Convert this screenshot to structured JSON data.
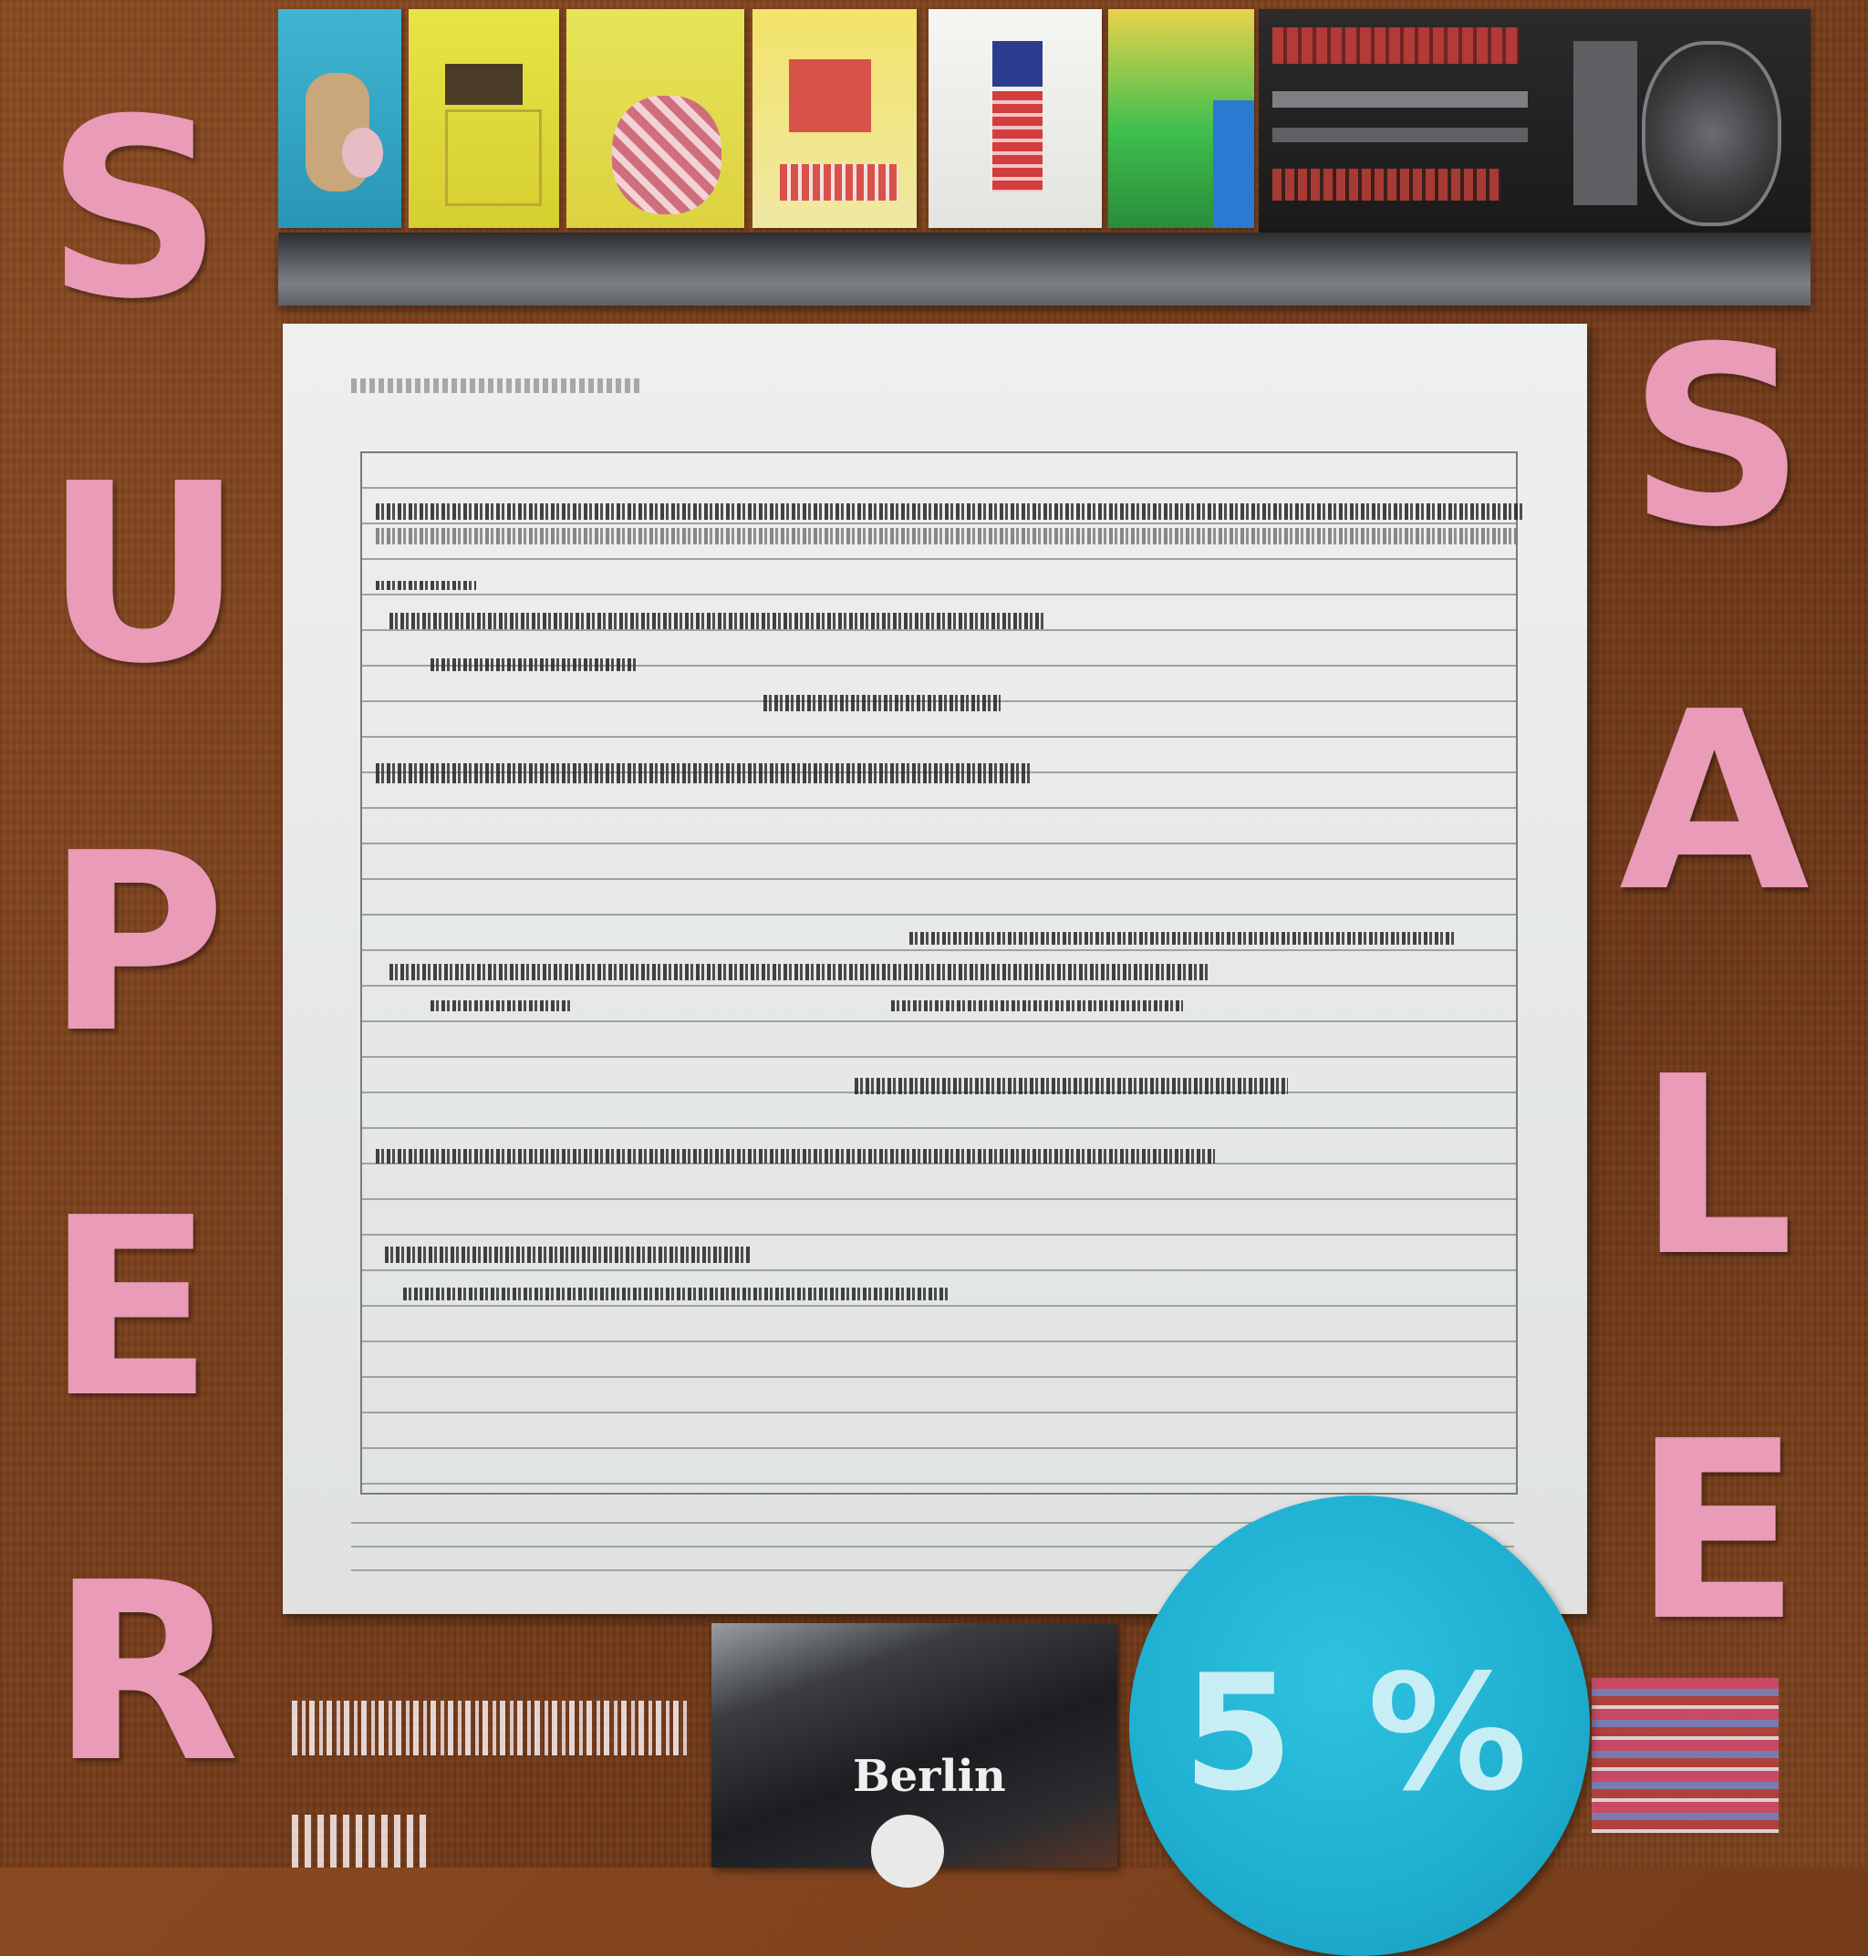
{
  "poster": {
    "left_word": [
      "S",
      "U",
      "P",
      "E",
      "R"
    ],
    "right_word": [
      "S",
      "A",
      "L",
      "E"
    ],
    "discount": "5 %",
    "book_title": "Berlin"
  },
  "colors": {
    "letters": "#e99bb8",
    "badge": "#1eaed0",
    "background": "#7a3f1c",
    "paper": "#e6e9e8"
  },
  "icons": {
    "shelf": "shelf-with-merchandise",
    "book": "book-icon"
  }
}
